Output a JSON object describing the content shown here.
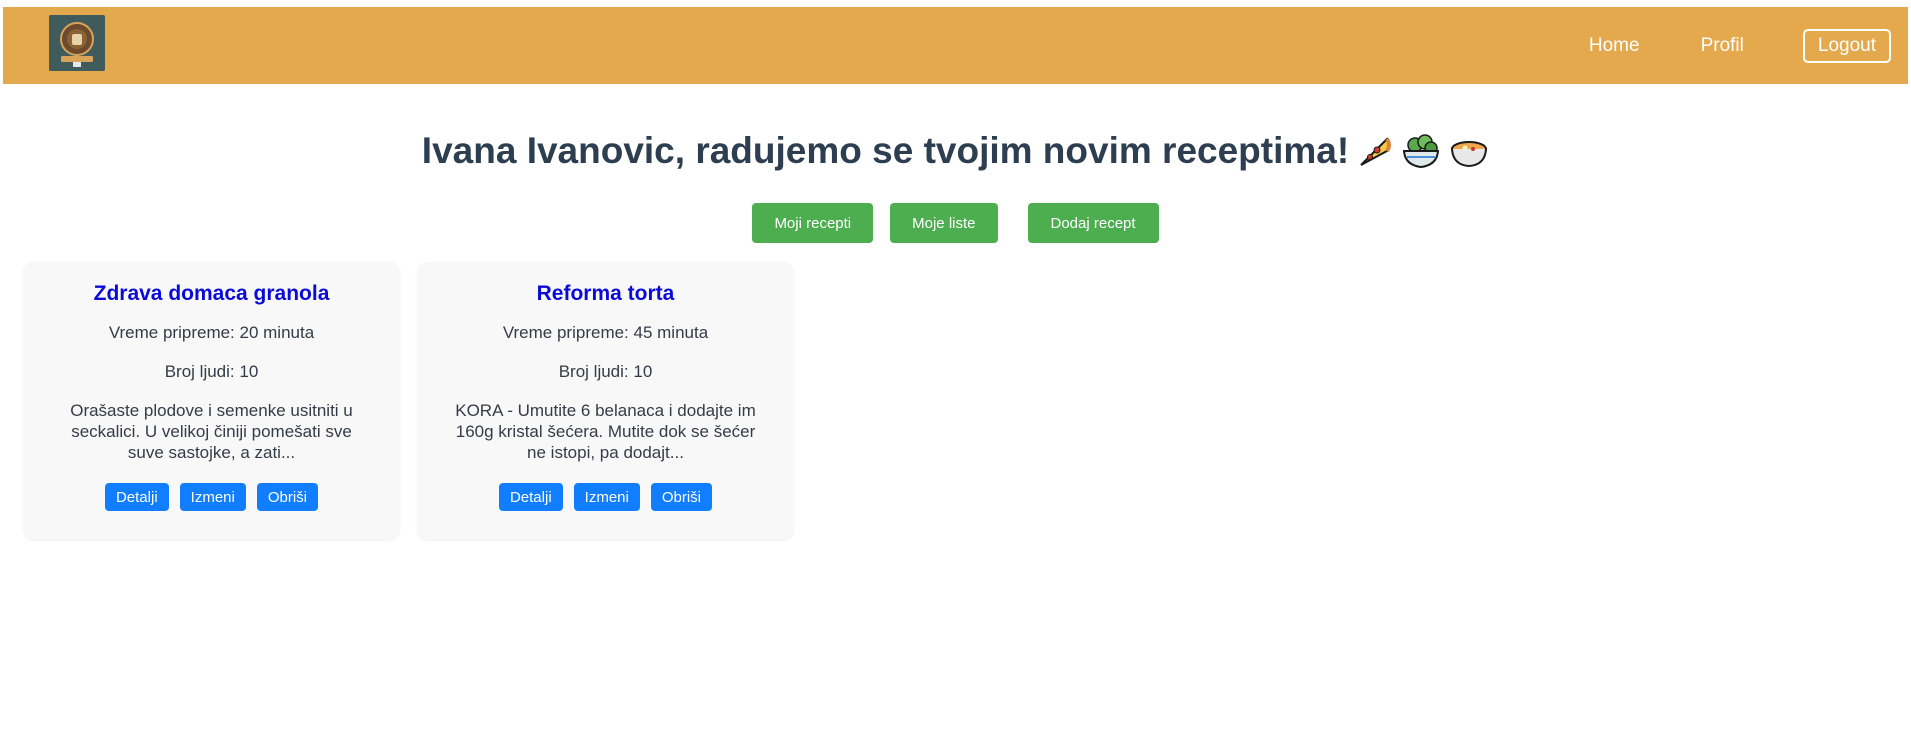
{
  "nav": {
    "home": "Home",
    "profil": "Profil",
    "logout": "Logout"
  },
  "page": {
    "title": "Ivana Ivanovic, radujemo se tvojim novim receptima!"
  },
  "actions": {
    "moji_recepti": "Moji recepti",
    "moje_liste": "Moje liste",
    "dodaj_recept": "Dodaj recept"
  },
  "recipes": [
    {
      "title": "Zdrava domaca granola",
      "prep_time": "Vreme pripreme: 20 minuta",
      "servings": "Broj ljudi: 10",
      "description": "Orašaste plodove i semenke usitniti u seckalici. U velikoj činiji pomešati sve suve sastojke, a zati...",
      "buttons": {
        "details": "Detalji",
        "edit": "Izmeni",
        "delete": "Obriši"
      }
    },
    {
      "title": "Reforma torta",
      "prep_time": "Vreme pripreme: 45 minuta",
      "servings": "Broj ljudi: 10",
      "description": "KORA - Umutite 6 belanaca i dodajte im 160g kristal šećera. Mutite dok se šećer ne istopi, pa dodajt...",
      "buttons": {
        "details": "Detalji",
        "edit": "Izmeni",
        "delete": "Obriši"
      }
    }
  ],
  "colors": {
    "navbar": "#e4a94c",
    "green_button": "#4cae4f",
    "blue_button": "#117dff",
    "recipe_title": "#0b0bd9",
    "heading": "#2c3e50"
  },
  "icons": [
    "recipe-vault-logo",
    "pizza-icon",
    "salad-icon",
    "soup-icon"
  ]
}
